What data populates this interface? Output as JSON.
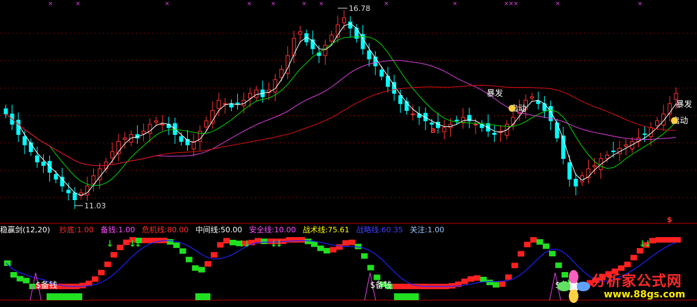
{
  "upper": {
    "high_label": "16.78",
    "low_label": "11.03",
    "signal_labels": [
      "暴发",
      "启动",
      "暴发",
      "启动"
    ],
    "buy_marker": "B",
    "dollar_marker": "$"
  },
  "indicator": {
    "name": "稳赢剑(12,20)",
    "params": [
      {
        "label": "抄底:1.00",
        "color": "#ff3030"
      },
      {
        "label": "备钱:1.00",
        "color": "#ff50ff"
      },
      {
        "label": "危机线:80.00",
        "color": "#ff3030"
      },
      {
        "label": "中间线:50.00",
        "color": "#ffffff"
      },
      {
        "label": "安全线:10.00",
        "color": "#ff50ff"
      },
      {
        "label": "战术线:75.61",
        "color": "#ffff00"
      },
      {
        "label": "战略线:60.35",
        "color": "#4040ff"
      },
      {
        "label": "关注:1.00",
        "color": "#a0c8ff"
      }
    ],
    "money_labels": [
      "$备钱",
      "$备钱",
      "$备钱"
    ]
  },
  "watermark": {
    "name": "分析家公式网",
    "url": "www.88gs.com"
  },
  "colors": {
    "up": "#ff3232",
    "down": "#00ffff",
    "ma_short": "#ffffff",
    "ma_mid": "#00dd00",
    "ma_long": "#e040e0",
    "ma_longer": "#e01010",
    "strategy": "#2020ff",
    "grid": "#7a0000"
  },
  "chart_data": {
    "type": "candlestick",
    "price_max": 16.78,
    "price_min": 11.03,
    "closes": [
      13.7,
      13.4,
      13.1,
      12.8,
      12.6,
      12.3,
      12.2,
      12.0,
      11.8,
      11.6,
      11.4,
      11.2,
      11.4,
      11.6,
      11.9,
      12.1,
      12.3,
      12.6,
      12.9,
      13.0,
      13.1,
      13.0,
      13.2,
      13.4,
      13.5,
      13.4,
      13.3,
      13.1,
      12.9,
      12.8,
      12.9,
      13.2,
      13.5,
      13.8,
      14.1,
      14.0,
      13.9,
      14.0,
      14.1,
      14.3,
      14.4,
      14.2,
      14.4,
      14.7,
      15.0,
      15.4,
      15.9,
      16.1,
      15.8,
      15.6,
      15.4,
      15.7,
      16.0,
      16.3,
      16.5,
      16.2,
      15.9,
      15.6,
      15.3,
      15.1,
      14.8,
      14.5,
      14.3,
      14.0,
      13.8,
      13.7,
      13.6,
      13.5,
      13.4,
      13.3,
      13.3,
      13.4,
      13.5,
      13.6,
      13.5,
      13.4,
      13.3,
      13.2,
      13.1,
      13.2,
      13.4,
      13.6,
      13.9,
      14.1,
      14.2,
      14.0,
      13.8,
      13.5,
      13.0,
      12.4,
      11.8,
      11.6,
      11.9,
      12.1,
      12.2,
      12.4,
      12.5,
      12.6,
      12.7,
      12.8,
      12.9,
      13.0,
      13.1,
      13.3,
      13.5,
      13.7,
      14.0,
      14.3
    ],
    "note_high_index": 53,
    "note_low_index": 11
  }
}
